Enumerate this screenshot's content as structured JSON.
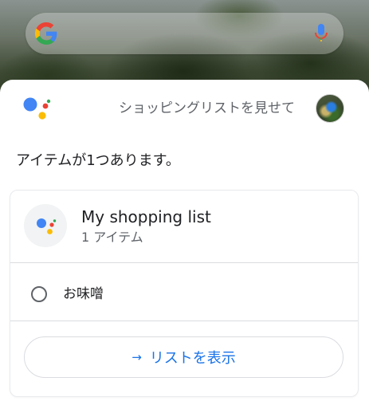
{
  "search_bar": {
    "logo_icon": "google-g-logo",
    "mic_icon": "microphone-icon"
  },
  "assistant": {
    "logo_icon": "google-assistant-dots-logo",
    "query": "ショッピングリストを見せて",
    "avatar": "user-avatar-photo"
  },
  "response": {
    "text": "アイテムが1つあります。"
  },
  "shopping_card": {
    "icon": "google-assistant-dots-logo",
    "title": "My shopping list",
    "count": "1 アイテム",
    "items": [
      {
        "label": "お味噌",
        "checked": false
      }
    ],
    "show_button": {
      "arrow": "→",
      "label": "リストを表示"
    }
  },
  "colors": {
    "assistant_blue": "#4285F4",
    "assistant_red": "#EA4335",
    "assistant_yellow": "#FBBC05",
    "assistant_green": "#34A853",
    "link_blue": "#1A73E8"
  }
}
